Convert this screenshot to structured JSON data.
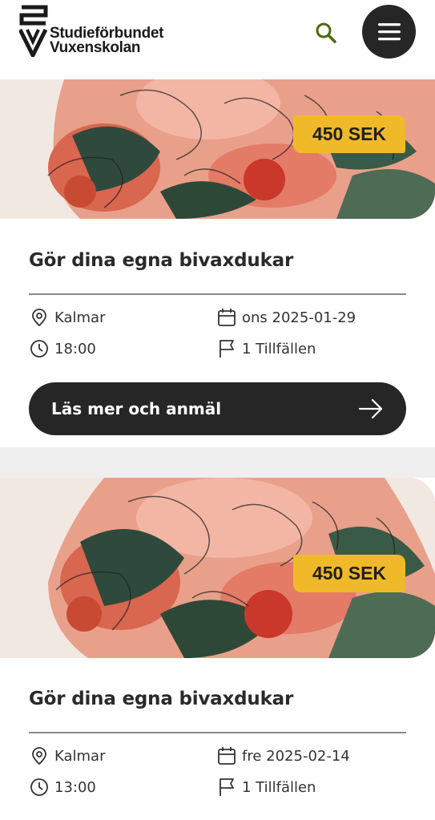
{
  "header": {
    "logo_line1": "Studieförbundet",
    "logo_line2": "Vuxenskolan",
    "search_icon": "search-icon",
    "menu_icon": "hamburger-menu-icon"
  },
  "courses": [
    {
      "price": "450 SEK",
      "title": "Gör dina egna bivaxdukar",
      "location": "Kalmar",
      "date": "ons 2025-01-29",
      "time": "18:00",
      "sessions": "1 Tillfällen",
      "cta": "Läs mer och anmäl"
    },
    {
      "price": "450 SEK",
      "title": "Gör dina egna bivaxdukar",
      "location": "Kalmar",
      "date": "fre 2025-02-14",
      "time": "13:00",
      "sessions": "1 Tillfällen"
    }
  ],
  "colors": {
    "accent": "#f0b92a",
    "dark": "#262626",
    "search_icon": "#4a6a12"
  }
}
